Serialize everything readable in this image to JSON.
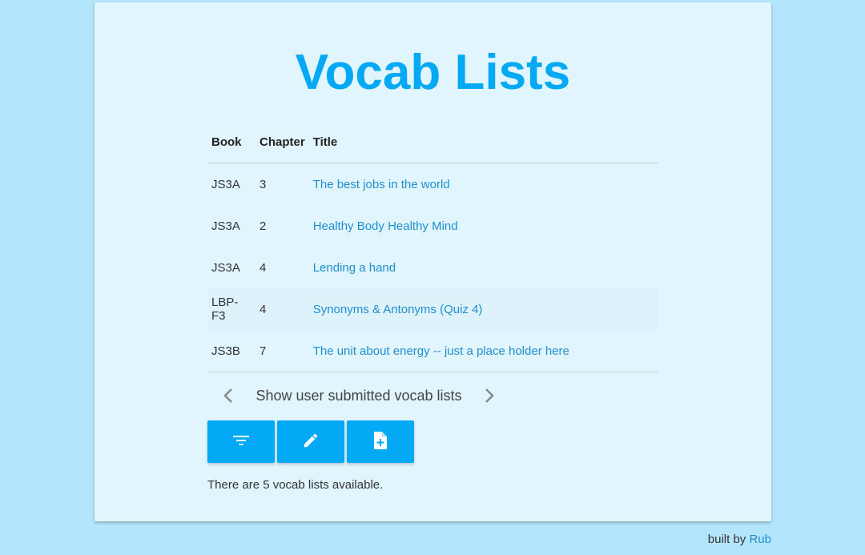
{
  "header": {
    "title": "Vocab Lists"
  },
  "table": {
    "columns": {
      "book": "Book",
      "chapter": "Chapter",
      "title": "Title"
    },
    "rows": [
      {
        "book": "JS3A",
        "chapter": "3",
        "title": "The best jobs in the world"
      },
      {
        "book": "JS3A",
        "chapter": "2",
        "title": "Healthy Body Healthy Mind"
      },
      {
        "book": "JS3A",
        "chapter": "4",
        "title": "Lending a hand"
      },
      {
        "book": "LBP-F3",
        "chapter": "4",
        "title": "Synonyms & Antonyms (Quiz 4)"
      },
      {
        "book": "JS3B",
        "chapter": "7",
        "title": "The unit about energy -- just a place holder here"
      }
    ]
  },
  "pager": {
    "label": "Show user submitted vocab lists",
    "prev_icon": "chevron-left-icon",
    "next_icon": "chevron-right-icon"
  },
  "toolbar": {
    "buttons": [
      "filter-icon",
      "pencil-icon",
      "add-document-icon"
    ]
  },
  "status": "There are 5 vocab lists available.",
  "footer": {
    "prefix": "built by",
    "link": "Rub"
  },
  "colors": {
    "background": "#b3e5fc",
    "card": "#e1f5fe",
    "accent": "#03a9f4",
    "link": "#1e8fd0"
  }
}
